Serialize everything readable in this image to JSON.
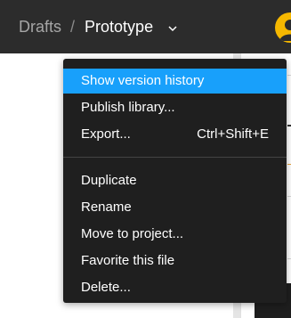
{
  "header": {
    "breadcrumb_parent": "Drafts",
    "breadcrumb_separator": "/",
    "file_name": "Prototype",
    "chevron_icon": "chevron-down-icon",
    "avatar_icon": "user-avatar-icon"
  },
  "menu": {
    "items": [
      {
        "label": "Show version history",
        "highlighted": true
      },
      {
        "label": "Publish library..."
      },
      {
        "label": "Export...",
        "shortcut": "Ctrl+Shift+E"
      },
      {
        "label": "Duplicate"
      },
      {
        "label": "Rename"
      },
      {
        "label": "Move to project..."
      },
      {
        "label": "Favorite this file"
      },
      {
        "label": "Delete..."
      }
    ]
  },
  "colors": {
    "topbar": "#2c2c2c",
    "menu_background": "#1f1f1f",
    "highlight": "#18a0fb",
    "avatar": "#f6b800"
  }
}
